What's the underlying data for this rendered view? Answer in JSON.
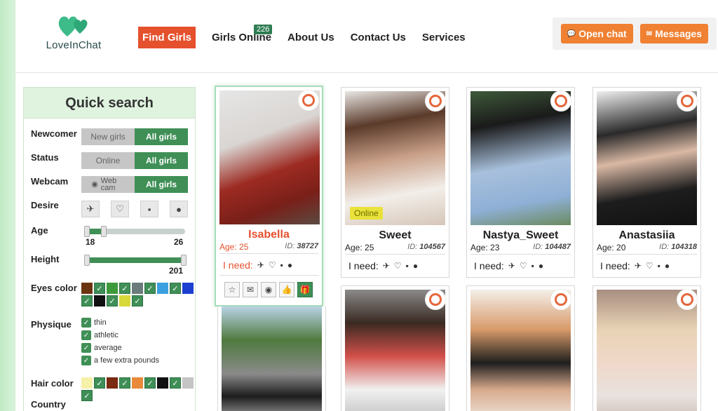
{
  "header": {
    "brand": "LoveInChat",
    "nav": [
      {
        "label": "Find Girls",
        "active": true
      },
      {
        "label": "Girls Online",
        "badge": "226"
      },
      {
        "label": "About Us"
      },
      {
        "label": "Contact Us"
      },
      {
        "label": "Services"
      }
    ],
    "open_chat": "Open chat",
    "messages": "Messages"
  },
  "quick_search": {
    "title": "Quick search",
    "newcomer": {
      "label": "Newcomer",
      "options": [
        "New girls",
        "All girls"
      ]
    },
    "status": {
      "label": "Status",
      "options": [
        "Online",
        "All girls"
      ]
    },
    "webcam": {
      "label": "Webcam",
      "options": [
        "Web cam",
        "All girls"
      ]
    },
    "desire": {
      "label": "Desire"
    },
    "age": {
      "label": "Age",
      "min": "18",
      "max": "26"
    },
    "height": {
      "label": "Height",
      "max": "201"
    },
    "eyes": {
      "label": "Eyes color"
    },
    "physique": {
      "label": "Physique",
      "options": [
        "thin",
        "athletic",
        "average",
        "a few extra pounds"
      ]
    },
    "hair": {
      "label": "Hair color"
    },
    "country": {
      "label": "Country"
    }
  },
  "cards": [
    {
      "name": "Isabella",
      "age": "Age: 25",
      "id_label": "ID:",
      "id": "38727",
      "need": "I need:",
      "selected": true
    },
    {
      "name": "Sweet",
      "age": "Age: 25",
      "id_label": "ID:",
      "id": "104567",
      "need": "I need:",
      "online": "Online"
    },
    {
      "name": "Nastya_Sweet",
      "age": "Age: 23",
      "id_label": "ID:",
      "id": "104487",
      "need": "I need:"
    },
    {
      "name": "Anastasiia",
      "age": "Age: 20",
      "id_label": "ID:",
      "id": "104318",
      "need": "I need:"
    }
  ],
  "colors": {
    "accent": "#e5502d",
    "green": "#3f8f57",
    "orange": "#f08032"
  }
}
